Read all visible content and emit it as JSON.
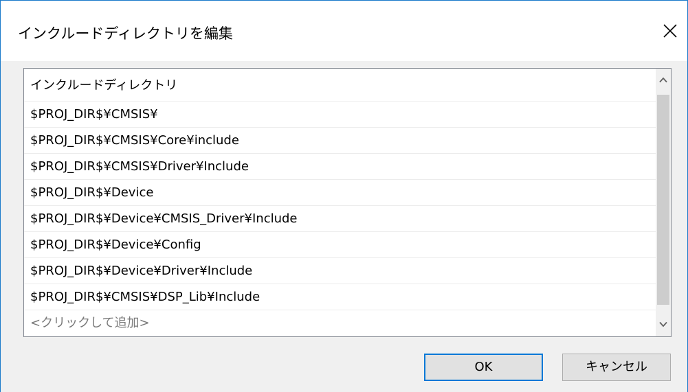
{
  "dialog": {
    "title": "インクルードディレクトリを編集",
    "close_symbol": "×"
  },
  "list": {
    "header": "インクルードディレクトリ",
    "items": [
      "$PROJ_DIR$¥CMSIS¥",
      "$PROJ_DIR$¥CMSIS¥Core¥include",
      "$PROJ_DIR$¥CMSIS¥Driver¥Include",
      "$PROJ_DIR$¥Device",
      "$PROJ_DIR$¥Device¥CMSIS_Driver¥Include",
      "$PROJ_DIR$¥Device¥Config",
      "$PROJ_DIR$¥Device¥Driver¥Include",
      "$PROJ_DIR$¥CMSIS¥DSP_Lib¥Include"
    ],
    "add_placeholder": "<クリックして追加>"
  },
  "buttons": {
    "ok_label": "OK",
    "cancel_label": "キャンセル"
  },
  "icons": {
    "close": "close-icon",
    "scroll_up": "chevron-up-icon",
    "scroll_down": "chevron-down-icon"
  },
  "colors": {
    "accent": "#0078d7",
    "window_border": "#1979ca",
    "dialog_bg": "#f0f0f0",
    "placeholder_text": "#7a7a7a"
  }
}
